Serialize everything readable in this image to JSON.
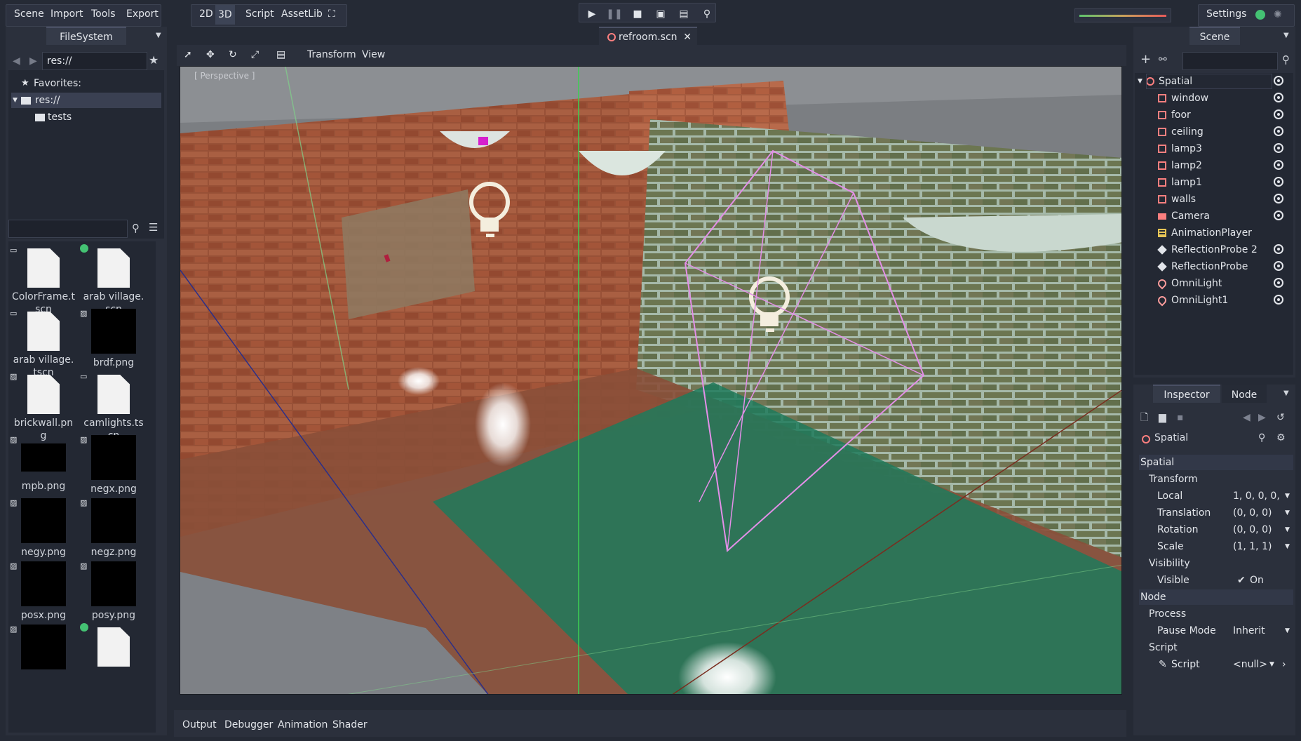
{
  "menu": {
    "scene": "Scene",
    "import": "Import",
    "tools": "Tools",
    "export": "Export"
  },
  "modes": {
    "m2d": "2D",
    "m3d": "3D",
    "script": "Script",
    "assetlib": "AssetLib"
  },
  "settings_label": "Settings",
  "filesystem": {
    "tab": "FileSystem",
    "path": "res://",
    "favorites": "Favorites:",
    "root": "res://",
    "folder": "tests",
    "search_placeholder": "",
    "files": [
      {
        "name": "ColorFrame.tscn",
        "kind": "doc"
      },
      {
        "name": "arab village.scn",
        "kind": "doc"
      },
      {
        "name": "arab village.tscn",
        "kind": "doc"
      },
      {
        "name": "brdf.png",
        "kind": "img"
      },
      {
        "name": "brickwall.png",
        "kind": "doc"
      },
      {
        "name": "camlights.tscn",
        "kind": "doc"
      },
      {
        "name": "mpb.png",
        "kind": "img"
      },
      {
        "name": "negx.png",
        "kind": "img"
      },
      {
        "name": "negy.png",
        "kind": "img"
      },
      {
        "name": "negz.png",
        "kind": "img"
      },
      {
        "name": "posx.png",
        "kind": "img"
      },
      {
        "name": "posy.png",
        "kind": "img"
      },
      {
        "name": "",
        "kind": "img"
      },
      {
        "name": "",
        "kind": "doc"
      }
    ]
  },
  "editor_tab": "refroom.scn",
  "viewport": {
    "transform": "Transform",
    "view": "View",
    "perspective": "[ Perspective ]"
  },
  "bottom_tabs": {
    "output": "Output",
    "debugger": "Debugger",
    "animation": "Animation",
    "shader": "Shader"
  },
  "scene_panel": {
    "tab": "Scene",
    "search_placeholder": "",
    "nodes": [
      {
        "name": "Spatial",
        "type": "spatial"
      },
      {
        "name": "window",
        "type": "mesh"
      },
      {
        "name": "foor",
        "type": "mesh"
      },
      {
        "name": "ceiling",
        "type": "mesh"
      },
      {
        "name": "lamp3",
        "type": "mesh"
      },
      {
        "name": "lamp2",
        "type": "mesh"
      },
      {
        "name": "lamp1",
        "type": "mesh"
      },
      {
        "name": "walls",
        "type": "mesh"
      },
      {
        "name": "Camera",
        "type": "camera"
      },
      {
        "name": "AnimationPlayer",
        "type": "anim"
      },
      {
        "name": "ReflectionProbe 2",
        "type": "probe"
      },
      {
        "name": "ReflectionProbe",
        "type": "probe"
      },
      {
        "name": "OmniLight",
        "type": "light"
      },
      {
        "name": "OmniLight1",
        "type": "light"
      }
    ]
  },
  "inspector": {
    "tab_inspector": "Inspector",
    "tab_node": "Node",
    "object": "Spatial",
    "section_spatial": "Spatial",
    "group_transform": "Transform",
    "local_label": "Local",
    "local_value": "1, 0, 0, 0,",
    "translation_label": "Translation",
    "translation_value": "(0, 0, 0)",
    "rotation_label": "Rotation",
    "rotation_value": "(0, 0, 0)",
    "scale_label": "Scale",
    "scale_value": "(1, 1, 1)",
    "group_visibility": "Visibility",
    "visible_label": "Visible",
    "visible_value": "On",
    "section_node": "Node",
    "group_process": "Process",
    "pause_label": "Pause Mode",
    "pause_value": "Inherit",
    "group_script": "Script",
    "script_label": "Script",
    "script_value": "<null>"
  },
  "colors": {
    "accent": "#6ba0e8",
    "ok": "#44c273",
    "mesh": "#fc7f7f",
    "light": "#fc9c9c",
    "camera": "#fc7f7f",
    "anim": "#e6c557"
  }
}
